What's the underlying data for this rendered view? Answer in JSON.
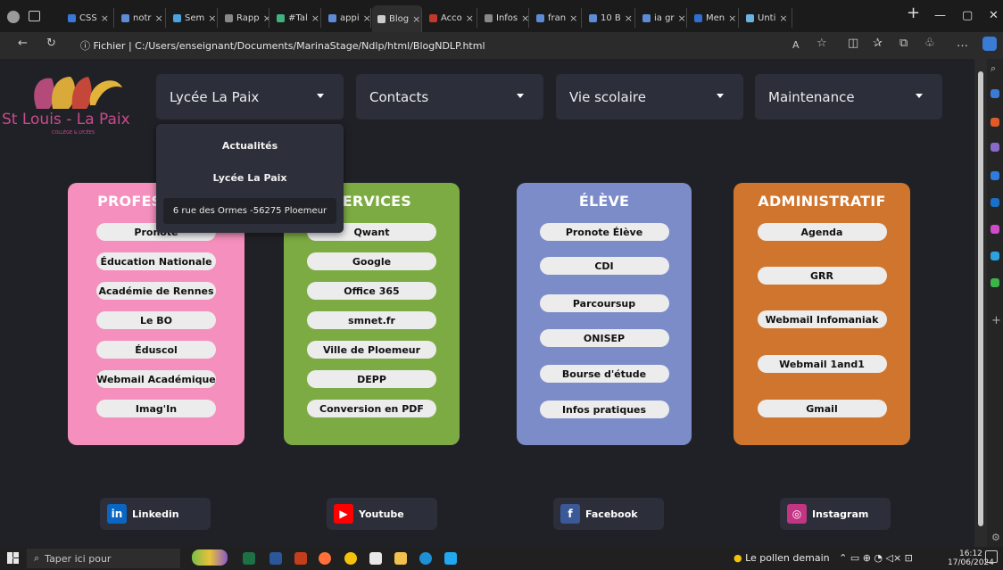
{
  "browser": {
    "tabs": [
      {
        "label": "CSS",
        "color": "#3a78d8"
      },
      {
        "label": "notr",
        "color": "#5d8bd6"
      },
      {
        "label": "Sem",
        "color": "#4aa3df"
      },
      {
        "label": "Rapp",
        "color": "#888888"
      },
      {
        "label": "#Tal",
        "color": "#3fb27f"
      },
      {
        "label": "appi",
        "color": "#5d8bd6"
      },
      {
        "label": "Blog",
        "color": "#cccccc"
      },
      {
        "label": "Acco",
        "color": "#c0392b"
      },
      {
        "label": "Infos",
        "color": "#888888"
      },
      {
        "label": "fran",
        "color": "#5d8bd6"
      },
      {
        "label": "10 B",
        "color": "#5d8bd6"
      },
      {
        "label": "ia gr",
        "color": "#5d8bd6"
      },
      {
        "label": "Men",
        "color": "#2f6fd0"
      },
      {
        "label": "Unti",
        "color": "#6bb3e0"
      }
    ],
    "address_prefix": "ⓘ Fichier",
    "address": "C:/Users/enseignant/Documents/MarinaStage/Ndlp/html/BlogNDLP.html"
  },
  "site": {
    "logo_text": "St Louis - La Paix",
    "logo_subtext": "COLLÈGE & LYCÉES",
    "nav": [
      {
        "label": "Lycée La Paix"
      },
      {
        "label": "Contacts"
      },
      {
        "label": "Vie scolaire"
      },
      {
        "label": "Maintenance"
      }
    ],
    "dropdown": [
      "Actualités",
      "Lycée La Paix",
      "6 rue des Ormes -56275 Ploemeur"
    ],
    "cards": [
      {
        "title": "PROFESSEURS",
        "color": "#f58fbd",
        "links": [
          "Pronote",
          "Éducation Nationale",
          "Académie de Rennes",
          "Le BO",
          "Éduscol",
          "Webmail Académique",
          "Imag'In"
        ]
      },
      {
        "title": "SERVICES",
        "color": "#7cab43",
        "links": [
          "Qwant",
          "Google",
          "Office 365",
          "smnet.fr",
          "Ville de Ploemeur",
          "DEPP",
          "Conversion en PDF"
        ]
      },
      {
        "title": "ÉLÈVE",
        "color": "#7b8cc9",
        "links": [
          "Pronote Élève",
          "CDI",
          "Parcoursup",
          "ONISEP",
          "Bourse d'étude",
          "Infos pratiques"
        ]
      },
      {
        "title": "ADMINISTRATIF",
        "color": "#d0752e",
        "links": [
          "Agenda",
          "GRR",
          "Webmail Infomaniak",
          "Webmail 1and1",
          "Gmail"
        ]
      }
    ],
    "social": [
      {
        "label": "Linkedin",
        "icon": "linkedin-icon",
        "color": "#0a66c2",
        "glyph": "in"
      },
      {
        "label": "Youtube",
        "icon": "youtube-icon",
        "color": "#ff0000",
        "glyph": "▶"
      },
      {
        "label": "Facebook",
        "icon": "facebook-icon",
        "color": "#3b5998",
        "glyph": "f"
      },
      {
        "label": "Instagram",
        "icon": "instagram-icon",
        "color": "#c13584",
        "glyph": "◎"
      }
    ]
  },
  "taskbar": {
    "search_placeholder": "Taper ici pour",
    "weather": "Le pollen demain",
    "time": "16:12",
    "date": "17/06/2024"
  }
}
